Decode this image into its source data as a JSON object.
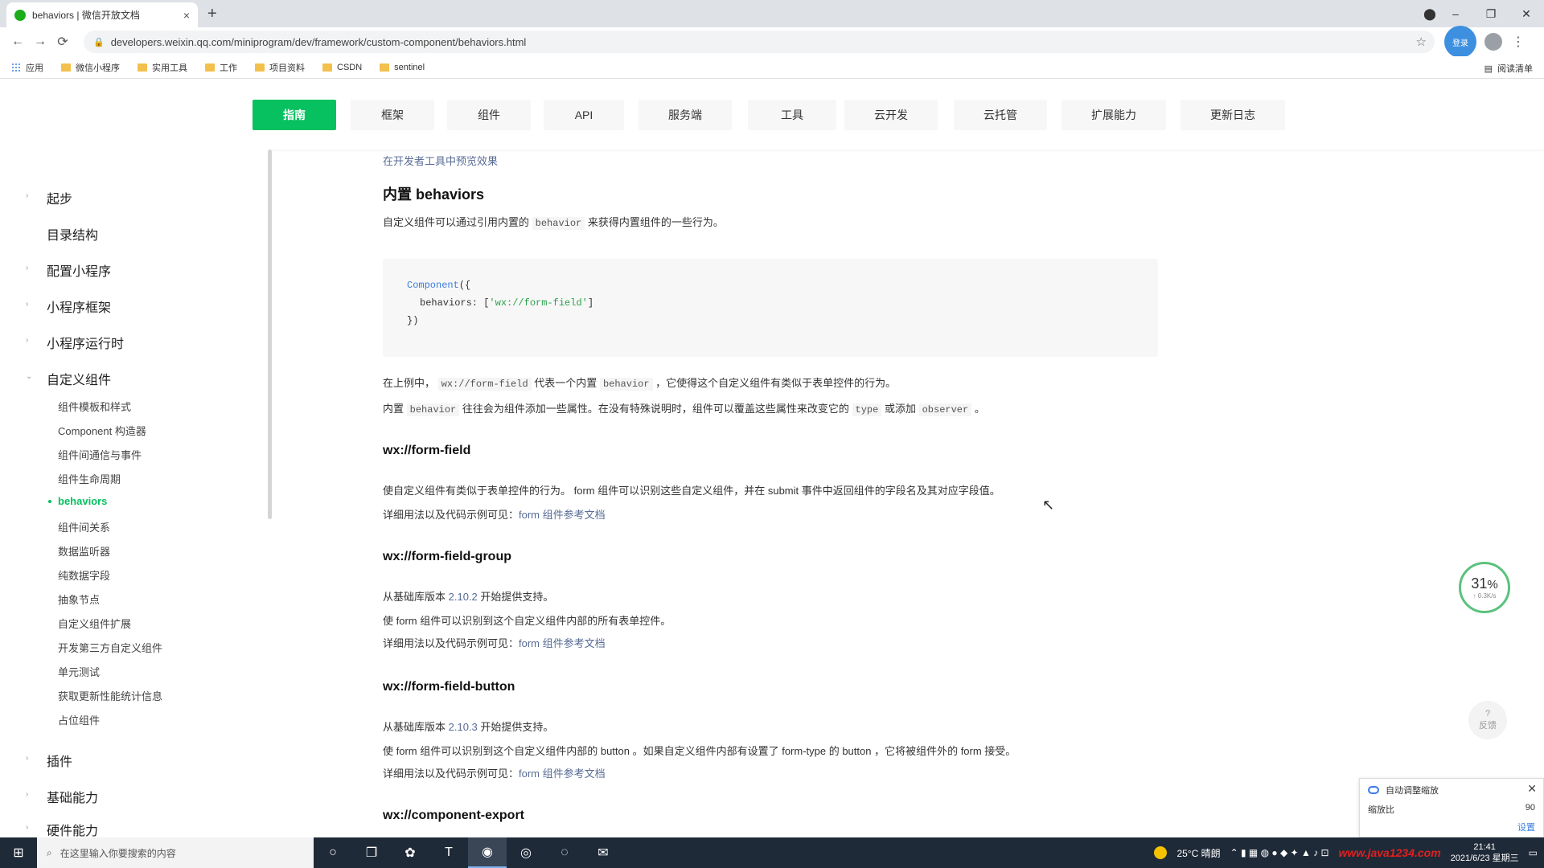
{
  "browser": {
    "tab_title": "behaviors | 微信开放文档",
    "tab_close": "×",
    "new_tab": "+",
    "url": "developers.weixin.qq.com/miniprogram/dev/framework/custom-component/behaviors.html",
    "profile_label": "登录",
    "window_min": "–",
    "window_restore": "❐",
    "window_close": "✕",
    "bookmarks": [
      "应用",
      "微信小程序",
      "实用工具",
      "工作",
      "项目资料",
      "CSDN",
      "sentinel"
    ],
    "reading_list": "阅读清单"
  },
  "nav": {
    "items": [
      "指南",
      "框架",
      "组件",
      "API",
      "服务端",
      "工具",
      "云开发",
      "云托管",
      "扩展能力",
      "更新日志"
    ],
    "active_index": 0
  },
  "sidebar": {
    "top_items": [
      "起步",
      "目录结构",
      "配置小程序",
      "小程序框架",
      "小程序运行时",
      "自定义组件"
    ],
    "sub_items": [
      "组件模板和样式",
      "Component 构造器",
      "组件间通信与事件",
      "组件生命周期",
      "behaviors",
      "组件间关系",
      "数据监听器",
      "纯数据字段",
      "抽象节点",
      "自定义组件扩展",
      "开发第三方自定义组件",
      "单元测试",
      "获取更新性能统计信息",
      "占位组件"
    ],
    "active_sub": "behaviors",
    "bottom_items": [
      "插件",
      "基础能力",
      "硬件能力"
    ]
  },
  "content": {
    "top_link": "在开发者工具中预览效果",
    "builtin_title": "内置 behaviors",
    "builtin_desc_1": "自定义组件可以通过引用内置的",
    "builtin_desc_code": "behavior",
    "builtin_desc_2": "来获得内置组件的一些行为。",
    "code_line1_kw": "Component",
    "code_line1_rest": "({",
    "code_line2_key": "behaviors: [",
    "code_line2_str": "'wx://form-field'",
    "code_line2_end": "]",
    "code_line3": "})",
    "para1_a": "在上例中，",
    "para1_code1": "wx://form-field",
    "para1_b": "代表一个内置",
    "para1_code2": "behavior",
    "para1_c": "，它使得这个自定义组件有类似于表单控件的行为。",
    "para2_a": "内置",
    "para2_code1": "behavior",
    "para2_b": "往往会为组件添加一些属性。在没有特殊说明时，组件可以覆盖这些属性来改变它的",
    "para2_code2": "type",
    "para2_c": "或添加",
    "para2_code3": "observer",
    "para2_d": "。",
    "s1_title": "wx://form-field",
    "s1_p1": "使自定义组件有类似于表单控件的行为。 form 组件可以识别这些自定义组件，并在 submit 事件中返回组件的字段名及其对应字段值。",
    "s1_p2_text": "详细用法以及代码示例可见：",
    "s1_p2_link": "form 组件参考文档",
    "s2_title": "wx://form-field-group",
    "s2_p1_text": "从基础库版本",
    "s2_p1_link": "2.10.2",
    "s2_p1_end": "开始提供支持。",
    "s2_p2": "使 form 组件可以识别到这个自定义组件内部的所有表单控件。",
    "s2_p3_text": "详细用法以及代码示例可见：",
    "s2_p3_link": "form 组件参考文档",
    "s3_title": "wx://form-field-button",
    "s3_p1_text": "从基础库版本",
    "s3_p1_link": "2.10.3",
    "s3_p1_end": "开始提供支持。",
    "s3_p2": "使 form 组件可以识别到这个自定义组件内部的 button 。如果自定义组件内部有设置了 form-type 的 button ，它将被组件外的 form 接受。",
    "s3_p3_text": "详细用法以及代码示例可见：",
    "s3_p3_link": "form 组件参考文档",
    "s4_title": "wx://component-export"
  },
  "widgets": {
    "progress_value": "31",
    "progress_unit": "%",
    "progress_sub": "↑ 0.3K/s",
    "progress_fraction": 0.31,
    "help_icon": "?",
    "help_label": "反馈",
    "notice_title": "自动调整缩放",
    "notice_body": "缩放比",
    "notice_value": "90",
    "notice_link": "设置",
    "notice_close": "✕"
  },
  "taskbar": {
    "search_placeholder": "在这里输入你要搜索的内容",
    "weather": "25°C 晴朗",
    "watermark": "www.java1234.com",
    "time": "21:41",
    "date": "2021/6/23 星期三"
  },
  "colors": {
    "accent": "#07c160",
    "link": "#576b95",
    "taskbar": "#1f2a38"
  }
}
